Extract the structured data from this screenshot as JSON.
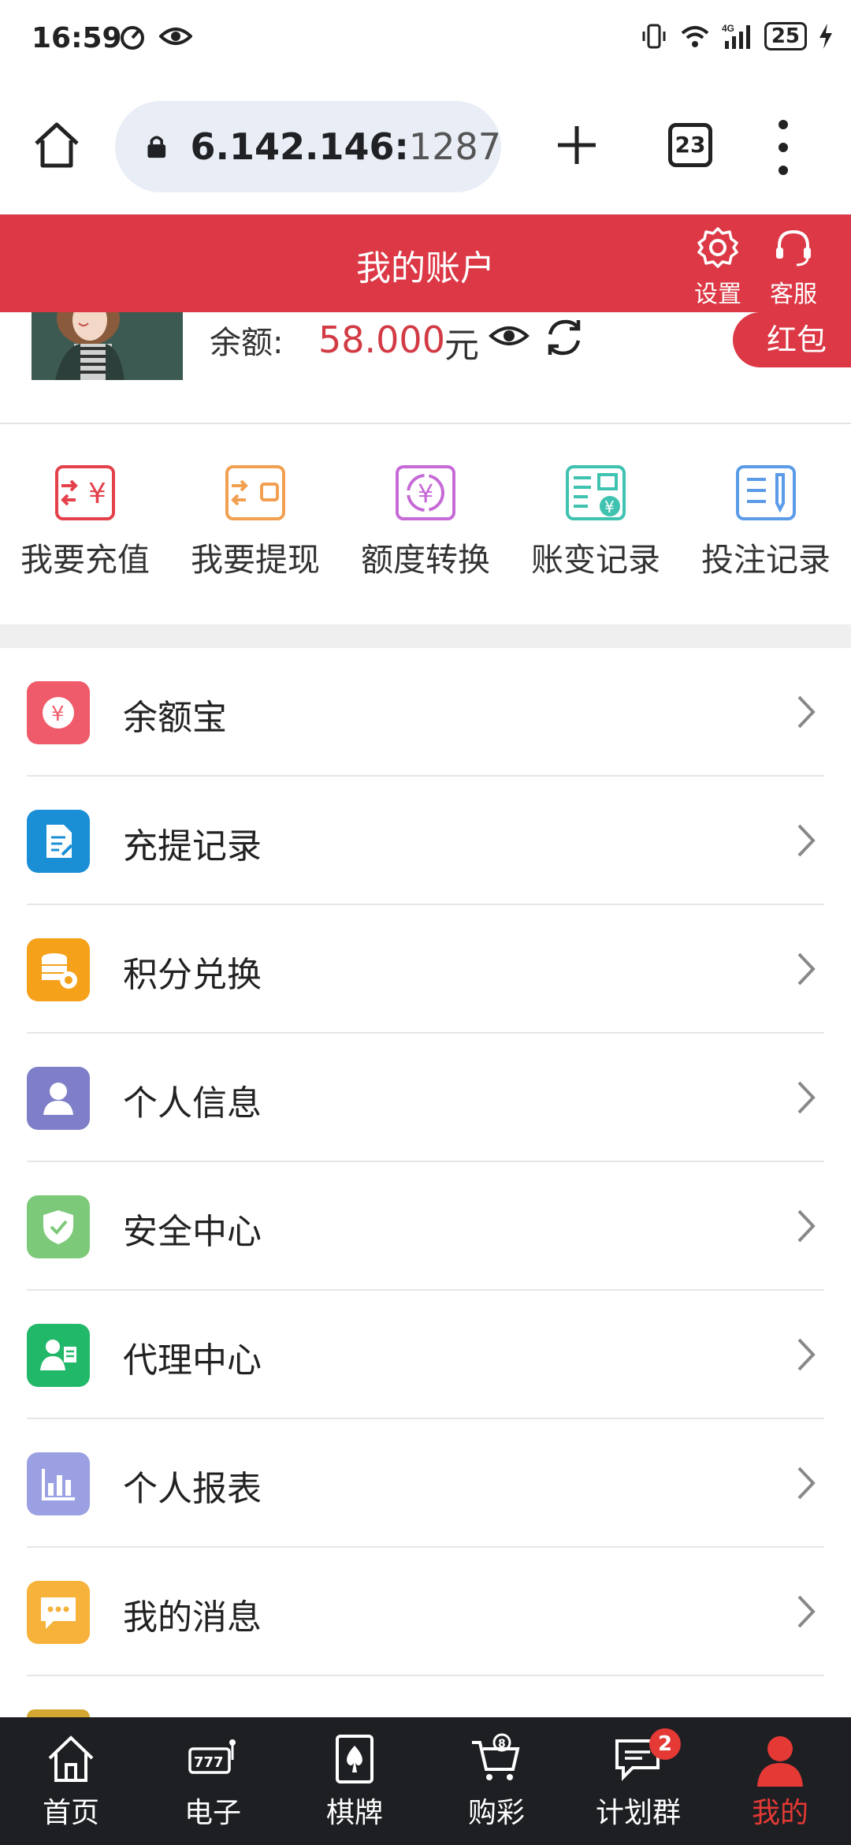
{
  "status_bar": {
    "time": "16:59",
    "battery": "25"
  },
  "browser": {
    "url_main": "6.142.146:",
    "url_port": "1287",
    "tab_count": "23"
  },
  "header": {
    "title": "我的账户",
    "settings_label": "设置",
    "service_label": "客服"
  },
  "profile": {
    "balance_label": "余额:",
    "balance_value": "58.000",
    "balance_unit": "元",
    "red_packet": "红包"
  },
  "quick_actions": [
    {
      "label": "我要充值",
      "icon": "recharge-icon",
      "color": "#e4414b"
    },
    {
      "label": "我要提现",
      "icon": "withdraw-icon",
      "color": "#f0a050"
    },
    {
      "label": "额度转换",
      "icon": "transfer-icon",
      "color": "#c66ad6"
    },
    {
      "label": "账变记录",
      "icon": "account-log-icon",
      "color": "#3fc2b0"
    },
    {
      "label": "投注记录",
      "icon": "bet-record-icon",
      "color": "#5b9be8"
    }
  ],
  "menu": [
    {
      "label": "余额宝",
      "icon": "yuebao-icon",
      "color": "#ef5b6a"
    },
    {
      "label": "充提记录",
      "icon": "deposit-record-icon",
      "color": "#1a8fd6"
    },
    {
      "label": "积分兑换",
      "icon": "points-exchange-icon",
      "color": "#f5a11a"
    },
    {
      "label": "个人信息",
      "icon": "user-icon",
      "color": "#7f7fc9"
    },
    {
      "label": "安全中心",
      "icon": "shield-icon",
      "color": "#7dc97a"
    },
    {
      "label": "代理中心",
      "icon": "agent-icon",
      "color": "#22b86a"
    },
    {
      "label": "个人报表",
      "icon": "report-icon",
      "color": "#9aa0e2"
    },
    {
      "label": "我的消息",
      "icon": "message-icon",
      "color": "#f7b23b"
    }
  ],
  "bottom_nav": [
    {
      "label": "首页",
      "icon": "home-icon"
    },
    {
      "label": "电子",
      "icon": "slot-icon"
    },
    {
      "label": "棋牌",
      "icon": "card-icon"
    },
    {
      "label": "购彩",
      "icon": "lottery-cart-icon"
    },
    {
      "label": "计划群",
      "icon": "chat-icon",
      "badge": "2"
    },
    {
      "label": "我的",
      "icon": "profile-icon",
      "active": true
    }
  ],
  "accent_color": "#dc3845"
}
